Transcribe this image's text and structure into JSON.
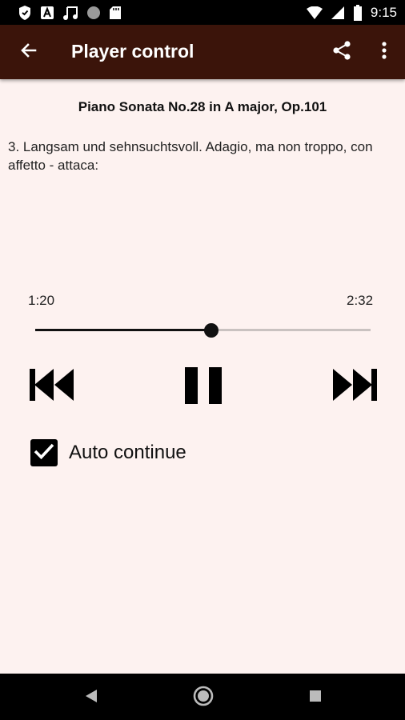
{
  "status_bar": {
    "time": "9:15",
    "left_icons": [
      "shield-icon",
      "a-box-icon",
      "music-note-icon",
      "circle-icon",
      "sd-card-icon"
    ],
    "right_icons": [
      "wifi-icon",
      "signal-icon",
      "battery-icon"
    ]
  },
  "app_bar": {
    "title": "Player control",
    "background": "#3b140a",
    "icons": [
      "back-arrow-icon",
      "share-icon",
      "more-vert-icon"
    ]
  },
  "player": {
    "work_title": "Piano Sonata No.28 in A major, Op.101",
    "movement": "3. Langsam und sehnsuchtsvoll. Adagio, ma non troppo, con affetto - attaca:",
    "current_time": "1:20",
    "total_time": "2:32",
    "progress": 0.526,
    "state": "playing",
    "controls": [
      "skip-previous-icon",
      "pause-icon",
      "skip-next-icon"
    ]
  },
  "auto_continue": {
    "label": "Auto continue",
    "checked": true
  },
  "nav_bar": {
    "icons": [
      "back-triangle-icon",
      "home-circle-icon",
      "recents-square-icon"
    ]
  },
  "colors": {
    "background": "#fdf2f0",
    "accent": "#111111"
  }
}
